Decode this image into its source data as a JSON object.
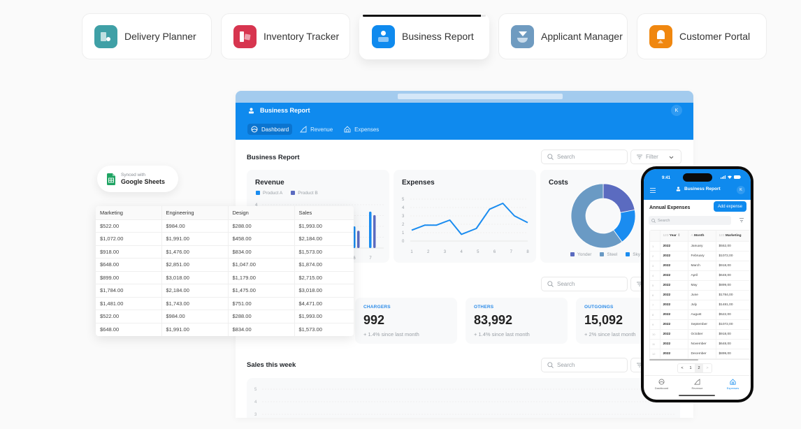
{
  "app_tabs": [
    {
      "label": "Delivery Planner",
      "icon": "delivery-planner-icon",
      "color": "#3fa0a6",
      "active": false
    },
    {
      "label": "Inventory Tracker",
      "icon": "inventory-tracker-icon",
      "color": "#d7354f",
      "active": false
    },
    {
      "label": "Business Report",
      "icon": "business-report-icon",
      "color": "#0f8aee",
      "active": true,
      "progress": 0.96
    },
    {
      "label": "Applicant Manager",
      "icon": "applicant-manager-icon",
      "color": "#6f9bc0",
      "active": false
    },
    {
      "label": "Customer Portal",
      "icon": "customer-portal-icon",
      "color": "#f0870f",
      "active": false
    }
  ],
  "colors": {
    "brand": "#0f8aee",
    "product_a": "#1a8cf0",
    "product_b": "#5b6bc0",
    "yonder": "#5b6bc0",
    "steel": "#6a9ac4",
    "sky": "#1a8cf0"
  },
  "window": {
    "app_title": "Business Report",
    "avatar_initial": "K",
    "nav": [
      {
        "label": "Dashboard",
        "icon": "dashboard-icon",
        "active": true
      },
      {
        "label": "Revenue",
        "icon": "revenue-icon",
        "active": false
      },
      {
        "label": "Expenses",
        "icon": "expenses-icon",
        "active": false
      }
    ],
    "section1": {
      "title": "Business Report",
      "search_placeholder": "Search",
      "filter_label": "Filter"
    },
    "section2": {
      "search_placeholder": "Search"
    },
    "section3": {
      "title": "Sales this week",
      "search_placeholder": "Search"
    },
    "stats": [
      {
        "label": "CHARGERS",
        "value": "992",
        "sub": "+ 1.4% since last month"
      },
      {
        "label": "OTHERS",
        "value": "83,992",
        "sub": "+ 1.4% since last month"
      },
      {
        "label": "OUTGOINGS",
        "value": "15,092",
        "sub": "+ 2% since last month"
      }
    ]
  },
  "chart_data": [
    {
      "type": "bar",
      "title": "Revenue",
      "legend": [
        "Product A",
        "Product B"
      ],
      "y_ticks": [
        "4"
      ],
      "x_ticks_visible": [
        "6",
        "7"
      ],
      "categories": [
        "6",
        "7"
      ],
      "series": [
        {
          "name": "Product A",
          "values": [
            2.5,
            4.2
          ]
        },
        {
          "name": "Product B",
          "values": [
            2.0,
            3.8
          ]
        }
      ],
      "ylim": [
        0,
        5
      ]
    },
    {
      "type": "line",
      "title": "Expenses",
      "x": [
        1,
        2,
        3,
        4,
        5,
        6,
        7,
        8
      ],
      "x_ticks": [
        "1",
        "2",
        "3",
        "4",
        "5",
        "6",
        "7",
        "8"
      ],
      "y_ticks": [
        "0",
        "1",
        "2",
        "3",
        "4",
        "5"
      ],
      "points": [
        [
          1,
          1.3
        ],
        [
          1.8,
          1.9
        ],
        [
          2.5,
          1.9
        ],
        [
          3.3,
          2.5
        ],
        [
          4,
          0.8
        ],
        [
          4.9,
          1.5
        ],
        [
          5.7,
          3.8
        ],
        [
          6.5,
          4.5
        ],
        [
          7.2,
          3.0
        ],
        [
          8,
          2.2
        ]
      ],
      "ylim": [
        0,
        5
      ],
      "grid": true
    },
    {
      "type": "pie",
      "title": "Costs",
      "labels": [
        "Yonder",
        "Steel",
        "Sky"
      ],
      "values": [
        22,
        60,
        18
      ],
      "donut": true
    },
    {
      "type": "line",
      "title": "Sales this week",
      "y_ticks": [
        "5",
        "4",
        "3"
      ],
      "series": [],
      "grid": true
    }
  ],
  "sync_chip": {
    "small": "Synced with",
    "big": "Google Sheets"
  },
  "sheet": {
    "columns": [
      "Marketing",
      "Engineering",
      "Design",
      "Sales"
    ],
    "rows": [
      [
        "$522.00",
        "$984.00",
        "$288.00",
        "$1,993.00"
      ],
      [
        "$1,072.00",
        "$1,991.00",
        "$458.00",
        "$2,184.00"
      ],
      [
        "$918.00",
        "$1,476.00",
        "$834.00",
        "$1,573.00"
      ],
      [
        "$648.00",
        "$2,851.00",
        "$1,047.00",
        "$1,874.00"
      ],
      [
        "$899.00",
        "$3,018.00",
        "$1,179.00",
        "$2,715.00"
      ],
      [
        "$1,784.00",
        "$2,184.00",
        "$1,475.00",
        "$3,018.00"
      ],
      [
        "$1,481.00",
        "$1,743.00",
        "$751.00",
        "$4,471.00"
      ],
      [
        "$522.00",
        "$984.00",
        "$288.00",
        "$1,993.00"
      ],
      [
        "$648.00",
        "$1,991.00",
        "$834.00",
        "$1,573.00"
      ]
    ]
  },
  "phone": {
    "time": "9:41",
    "title": "Business Report",
    "avatar_initial": "K",
    "heading": "Annual Expenses",
    "add_button": "Add expense",
    "search_placeholder": "Search",
    "columns": [
      "Year",
      "Month",
      "Marketing"
    ],
    "column_type_icons": [
      "123",
      "A",
      "123"
    ],
    "rows": [
      [
        "1",
        "2022",
        "January",
        "$552,00"
      ],
      [
        "2",
        "2022",
        "February",
        "$1072,00"
      ],
      [
        "3",
        "2022",
        "March",
        "$918,00"
      ],
      [
        "4",
        "2022",
        "April",
        "$648,00"
      ],
      [
        "5",
        "2022",
        "May",
        "$899,00"
      ],
      [
        "6",
        "2022",
        "June",
        "$1784,00"
      ],
      [
        "7",
        "2022",
        "July",
        "$1481,00"
      ],
      [
        "8",
        "2022",
        "August",
        "$522,00"
      ],
      [
        "9",
        "2022",
        "September",
        "$1072,00"
      ],
      [
        "10",
        "2022",
        "October",
        "$918,00"
      ],
      [
        "11",
        "2022",
        "November",
        "$648,00"
      ],
      [
        "12",
        "2022",
        "December",
        "$899,00"
      ]
    ],
    "pager": {
      "prev": "<",
      "pages": [
        "1",
        "2"
      ],
      "current": "2",
      "next": ">"
    },
    "bottom_nav": [
      {
        "label": "Dashboard",
        "icon": "dashboard-icon",
        "active": false
      },
      {
        "label": "Revenue",
        "icon": "revenue-icon",
        "active": false
      },
      {
        "label": "Expenses",
        "icon": "expenses-icon",
        "active": true
      }
    ]
  }
}
